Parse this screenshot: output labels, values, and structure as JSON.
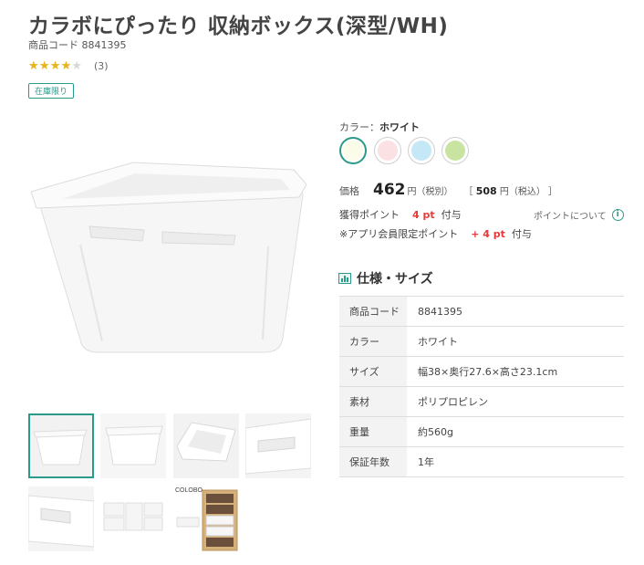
{
  "product": {
    "title": "カラボにぴったり 収納ボックス(深型/WH)",
    "code_label": "商品コード",
    "code_value": "8841395",
    "rating_count": "(3)",
    "rating_value": 3.5,
    "stars_bg": "★★★★★",
    "stars_fg": "★★★★★",
    "stock_badge": "在庫限り"
  },
  "color": {
    "label": "カラー：",
    "selected": "ホワイト",
    "swatches": [
      {
        "name": "ホワイト",
        "color": "#fbfbe9",
        "selected": true
      },
      {
        "name": "ピンク",
        "color": "#fbe1e4",
        "selected": false
      },
      {
        "name": "ブルー",
        "color": "#c4e8f5",
        "selected": false
      },
      {
        "name": "グリーン",
        "color": "#c8e4a0",
        "selected": false
      }
    ]
  },
  "price": {
    "label": "価格",
    "value": "462",
    "unit": "円（税別）",
    "incl_open": "［",
    "incl_value": "508",
    "incl_unit": "円（税込）",
    "incl_close": "］"
  },
  "points": {
    "label": "獲得ポイント",
    "value": "4 pt",
    "suffix": "付与",
    "about": "ポイントについて",
    "info_icon_glyph": "i",
    "app_label": "※アプリ会員限定ポイント",
    "app_value": "+ 4 pt",
    "app_suffix": "付与"
  },
  "spec": {
    "heading": "仕様・サイズ",
    "rows": [
      {
        "label": "商品コード",
        "value": "8841395"
      },
      {
        "label": "カラー",
        "value": "ホワイト"
      },
      {
        "label": "サイズ",
        "value": "幅38×奥行27.6×高さ23.1cm"
      },
      {
        "label": "素材",
        "value": "ポリプロピレン"
      },
      {
        "label": "重量",
        "value": "約560g"
      },
      {
        "label": "保証年数",
        "value": "1年"
      }
    ]
  },
  "gallery": {
    "brand_text": "COLOBO"
  },
  "colors": {
    "accent": "#2a9a8a",
    "point_red": "#e63a3a",
    "star": "#e8b41c"
  }
}
